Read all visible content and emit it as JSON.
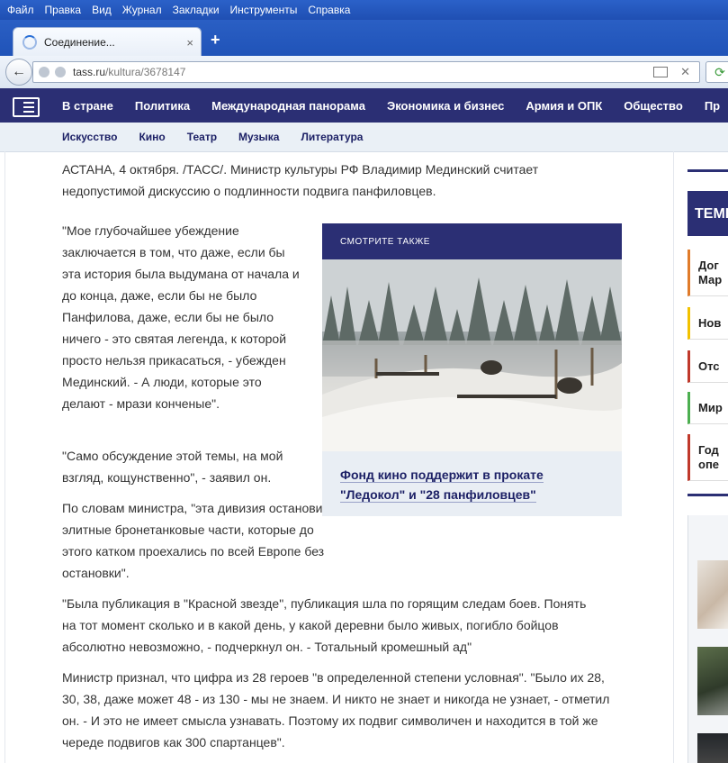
{
  "menubar": [
    "Файл",
    "Правка",
    "Вид",
    "Журнал",
    "Закладки",
    "Инструменты",
    "Справка"
  ],
  "tab": {
    "title": "Соединение...",
    "close": "×",
    "new_tab": "+"
  },
  "address": {
    "host": "tass.ru",
    "path": "/kultura/3678147"
  },
  "site_nav": [
    "В стране",
    "Политика",
    "Международная панорама",
    "Экономика и бизнес",
    "Армия и ОПК",
    "Общество",
    "Пр"
  ],
  "sub_nav": [
    "Искусство",
    "Кино",
    "Театр",
    "Музыка",
    "Литература"
  ],
  "article": {
    "lead": "АСТАНА, 4 октября. /ТАСС/. Министр культуры РФ Владимир Мединский считает недопустимой дискуссию о подлинности подвига панфиловцев.",
    "quote1": "\"Мое глубочайшее убеждение заключается в том, что даже, если бы эта история была выдумана от начала и до конца, даже, если бы не было Панфилова, даже, если бы не было ничего - это святая легенда, к которой просто нельзя прикасаться, - убежден Мединский. - А люди, которые это делают - мрази конченые\".",
    "quote2": "\"Само обсуждение этой темы, на мой взгляд, кощунственно\", - заявил он.",
    "p3": "По словам министра, \"эта дивизия остановила элитные бронетанковые части, которые до этого катком проехались по всей Европе без остановки\".",
    "p4": "\"Была публикация в \"Красной звезде\", публикация шла по горящим следам боев. Понять на тот момент сколько и в какой день, у какой деревни было живых, погибло бойцов абсолютно невозможно, - подчеркнул он. - Тотальный кромешный ад\"",
    "p5": "Министр признал, что цифра из 28 героев \"в определенной степени условная\". \"Было их 28, 30, 38, даже может 48 - из 130 - мы не знаем. И никто не знает и никогда не узнает, - отметил он. - И это не имеет смысла узнавать. Поэтому их подвиг символичен и находится в той же череде подвигов как 300 спартанцев\"."
  },
  "see_also": {
    "header": "СМОТРИТЕ ТАКЖЕ",
    "link": "Фонд кино поддержит в прокате \"Ледокол\" и \"28 панфиловцев\""
  },
  "right_col": {
    "themes": "ТЕМЫ",
    "items": [
      {
        "text": "Дог Мар",
        "color": "#e07b2a"
      },
      {
        "text": "Нов",
        "color": "#f2c200"
      },
      {
        "text": "Отс",
        "color": "#c0392b"
      },
      {
        "text": "Мир",
        "color": "#4caf50"
      },
      {
        "text": "Год опе",
        "color": "#c0392b"
      }
    ]
  },
  "colors": {
    "brand": "#2b2f74",
    "link": "#1d2166"
  }
}
